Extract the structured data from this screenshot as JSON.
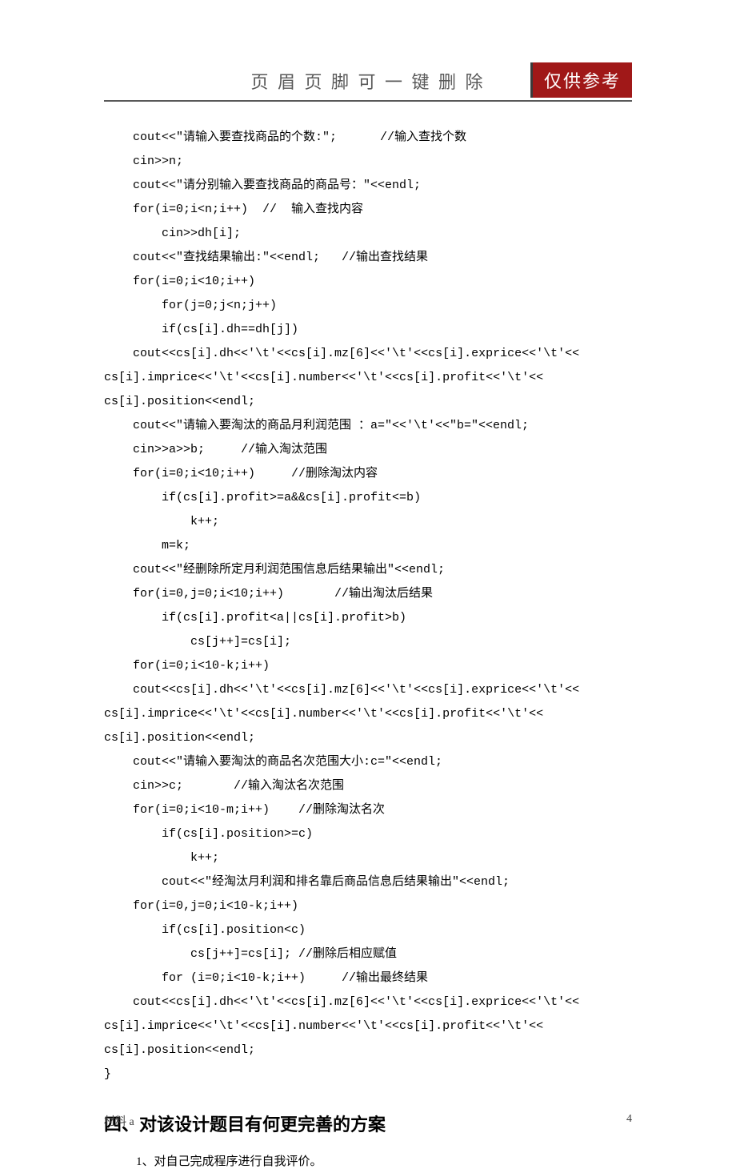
{
  "header": {
    "title": "页 眉 页 脚 可 一 键 删 除",
    "badge": "仅供参考"
  },
  "code": {
    "lines": [
      "    cout<<\"请输入要查找商品的个数:\";      //输入查找个数",
      "    cin>>n;",
      "    cout<<\"请分别输入要查找商品的商品号：\"<<endl;",
      "    for(i=0;i<n;i++)  //  输入查找内容",
      "        cin>>dh[i];",
      "    cout<<\"查找结果输出:\"<<endl;   //输出查找结果",
      "    for(i=0;i<10;i++)",
      "        for(j=0;j<n;j++)",
      "        if(cs[i].dh==dh[j])",
      "    cout<<cs[i].dh<<'\\t'<<cs[i].mz[6]<<'\\t'<<cs[i].exprice<<'\\t'<<",
      "cs[i].imprice<<'\\t'<<cs[i].number<<'\\t'<<cs[i].profit<<'\\t'<<",
      "cs[i].position<<endl;",
      "    cout<<\"请输入要淘汰的商品月利润范围 ：a=\"<<'\\t'<<\"b=\"<<endl;",
      "    cin>>a>>b;     //输入淘汰范围",
      "    for(i=0;i<10;i++)     //删除淘汰内容",
      "        if(cs[i].profit>=a&&cs[i].profit<=b)",
      "            k++;",
      "        m=k;",
      "    cout<<\"经删除所定月利润范围信息后结果输出\"<<endl;",
      "    for(i=0,j=0;i<10;i++)       //输出淘汰后结果",
      "        if(cs[i].profit<a||cs[i].profit>b)",
      "            cs[j++]=cs[i];",
      "    for(i=0;i<10-k;i++)",
      "    cout<<cs[i].dh<<'\\t'<<cs[i].mz[6]<<'\\t'<<cs[i].exprice<<'\\t'<<",
      "cs[i].imprice<<'\\t'<<cs[i].number<<'\\t'<<cs[i].profit<<'\\t'<<",
      "cs[i].position<<endl;",
      "    cout<<\"请输入要淘汰的商品名次范围大小:c=\"<<endl;",
      "    cin>>c;       //输入淘汰名次范围",
      "    for(i=0;i<10-m;i++)    //删除淘汰名次",
      "        if(cs[i].position>=c)",
      "            k++;",
      "        cout<<\"经淘汰月利润和排名靠后商品信息后结果输出\"<<endl;",
      "    for(i=0,j=0;i<10-k;i++)",
      "        if(cs[i].position<c)",
      "            cs[j++]=cs[i]; //删除后相应赋值",
      "        for (i=0;i<10-k;i++)     //输出最终结果",
      "    cout<<cs[i].dh<<'\\t'<<cs[i].mz[6]<<'\\t'<<cs[i].exprice<<'\\t'<<",
      "cs[i].imprice<<'\\t'<<cs[i].number<<'\\t'<<cs[i].profit<<'\\t'<<",
      "cs[i].position<<endl;",
      "}"
    ]
  },
  "section": {
    "heading": "四、对该设计题目有何更完善的方案",
    "sub1": "1、对自己完成程序进行自我评价。"
  },
  "footer": {
    "left": "材料 a",
    "right": "4"
  }
}
